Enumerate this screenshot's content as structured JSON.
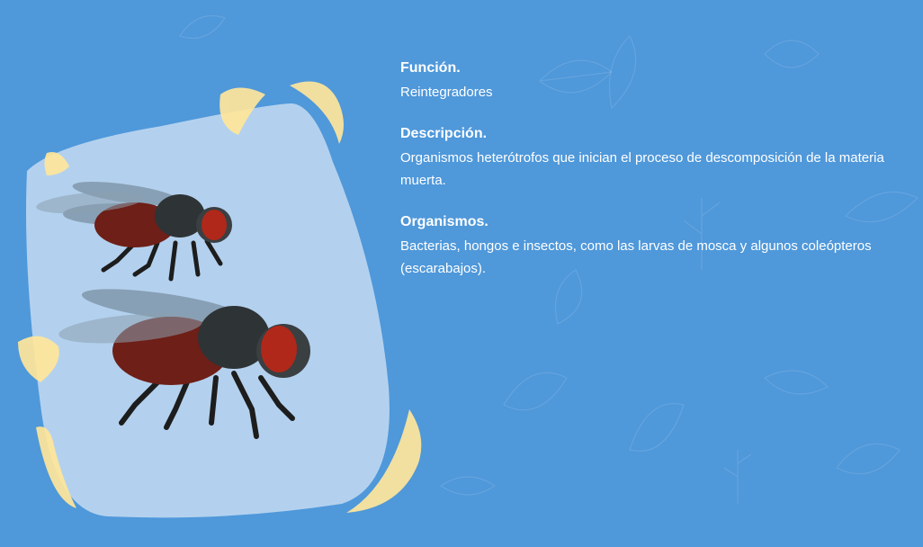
{
  "sections": [
    {
      "title": "Función.",
      "text": "Reintegradores"
    },
    {
      "title": "Descripción.",
      "text": "Organismos heterótrofos que inician el proceso de descomposición de la materia muerta."
    },
    {
      "title": "Organismos.",
      "text": "Bacterias, hongos e insectos, como las larvas de mosca y algunos coleópteros (escarabajos)."
    }
  ],
  "colors": {
    "background": "#4f98da",
    "panel": "#b3d1ee",
    "accent": "#ffe69a"
  }
}
